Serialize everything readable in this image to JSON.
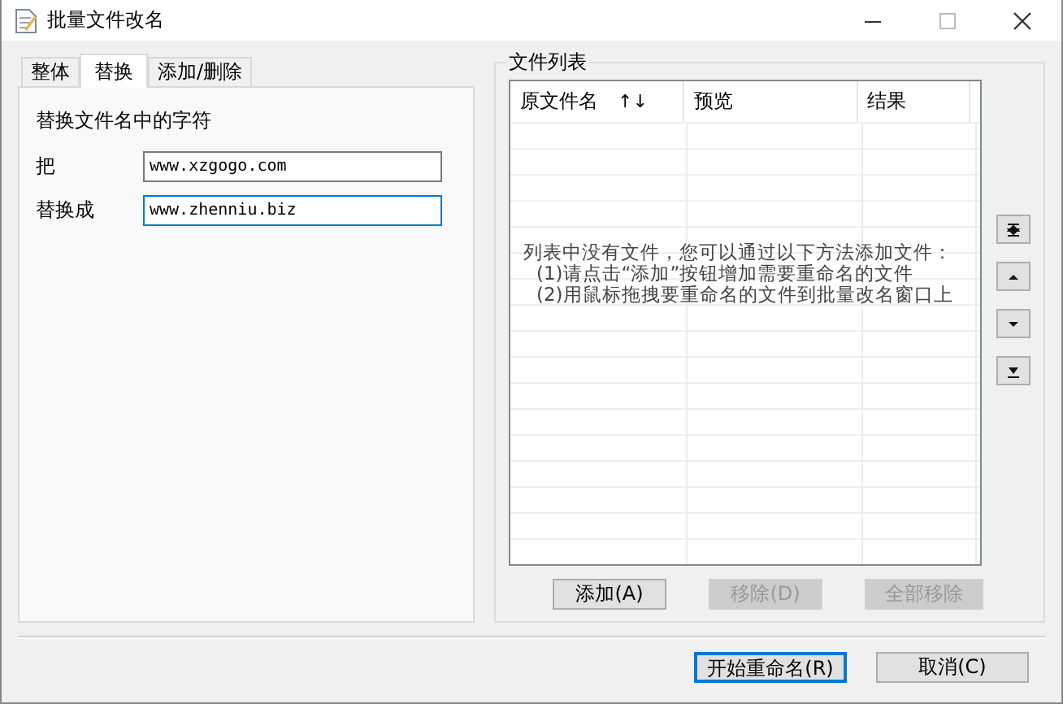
{
  "window": {
    "title": "批量文件改名"
  },
  "tabs": [
    {
      "label": "整体",
      "selected": false
    },
    {
      "label": "替换",
      "selected": true
    },
    {
      "label": "添加/删除",
      "selected": false
    }
  ],
  "replace_panel": {
    "heading": "替换文件名中的字符",
    "fields": [
      {
        "label": "把",
        "value": "www.xzgogo.com",
        "focused": false
      },
      {
        "label": "替换成",
        "value": "www.zhenniu.biz",
        "focused": true
      }
    ]
  },
  "file_list": {
    "title": "文件列表",
    "columns": [
      "原文件名",
      "预览",
      "结果"
    ],
    "sort_icon": "↑↓",
    "empty_message": [
      "列表中没有文件，您可以通过以下方法添加文件：",
      "(1)请点击“添加”按钮增加需要重命名的文件",
      "(2)用鼠标拖拽要重命名的文件到批量改名窗口上"
    ],
    "buttons": [
      {
        "label": "添加(A)",
        "disabled": false
      },
      {
        "label": "移除(D)",
        "disabled": true
      },
      {
        "label": "全部移除",
        "disabled": true
      }
    ]
  },
  "footer_buttons": [
    {
      "label": "开始重命名(R)",
      "default": true
    },
    {
      "label": "取消(C)",
      "default": false
    }
  ]
}
